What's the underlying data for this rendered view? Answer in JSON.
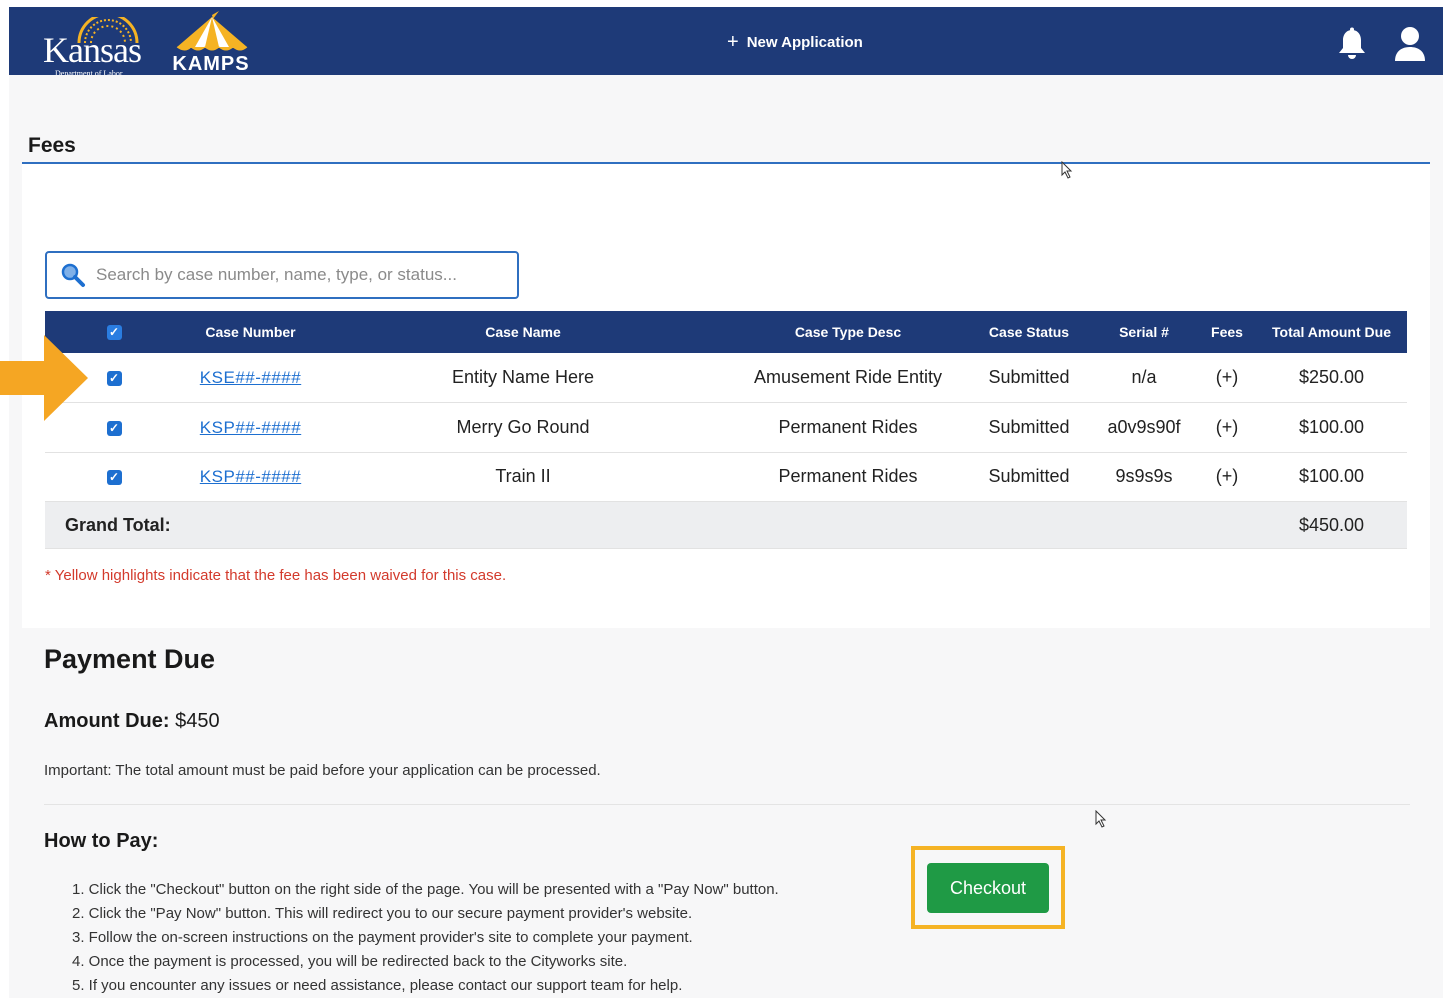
{
  "header": {
    "logo_kansas_text": "Kansas",
    "logo_kansas_subtext": "Department of Labor",
    "logo_kamps_text": "KAMPS",
    "new_application_label": "New Application"
  },
  "fees": {
    "title": "Fees",
    "search_placeholder": "Search by case number, name, type, or status...",
    "columns": [
      "Case Number",
      "Case Name",
      "Case Type Desc",
      "Case Status",
      "Serial #",
      "Fees",
      "Total Amount Due"
    ],
    "rows": [
      {
        "checked": true,
        "case_number": "KSE##-####",
        "case_name": "Entity Name Here",
        "case_type": "Amusement Ride Entity",
        "status": "Submitted",
        "serial": "n/a",
        "fees": "(+)",
        "total": "$250.00"
      },
      {
        "checked": true,
        "case_number": "KSP##-####",
        "case_name": "Merry Go Round",
        "case_type": "Permanent Rides",
        "status": "Submitted",
        "serial": "a0v9s90f",
        "fees": "(+)",
        "total": "$100.00"
      },
      {
        "checked": true,
        "case_number": "KSP##-####",
        "case_name": "Train II",
        "case_type": "Permanent Rides",
        "status": "Submitted",
        "serial": "9s9s9s",
        "fees": "(+)",
        "total": "$100.00"
      }
    ],
    "grand_total_label": "Grand Total:",
    "grand_total_value": "$450.00",
    "waiver_note": "* Yellow highlights indicate that the fee has been waived for this case."
  },
  "payment": {
    "title": "Payment Due",
    "amount_due_label": "Amount Due:",
    "amount_due_value": "$450",
    "important_note": "Important: The total amount must be paid before your application can be processed.",
    "how_to_title": "How to Pay:",
    "steps": [
      "1. Click the \"Checkout\" button on the right side of the page. You will be presented with a \"Pay Now\" button.",
      "2. Click the \"Pay Now\" button. This will redirect you to our secure payment provider's website.",
      "3. Follow the on-screen instructions on the payment provider's site to complete your payment.",
      "4. Once the payment is processed, you will be redirected back to the Cityworks site.",
      "5. If you encounter any issues or need assistance, please contact our support team for help."
    ],
    "checkout_label": "Checkout"
  },
  "colors": {
    "header_bg": "#1e3a78",
    "accent_blue": "#2f6fc0",
    "link_blue": "#1d6fd0",
    "checkout_green": "#1f9a45",
    "highlight_orange": "#f5b324",
    "note_red": "#d33a2c"
  },
  "icons": [
    "bell-icon",
    "user-icon",
    "search-icon",
    "plus-icon",
    "checkbox-checked-icon",
    "arrow-right-icon"
  ]
}
